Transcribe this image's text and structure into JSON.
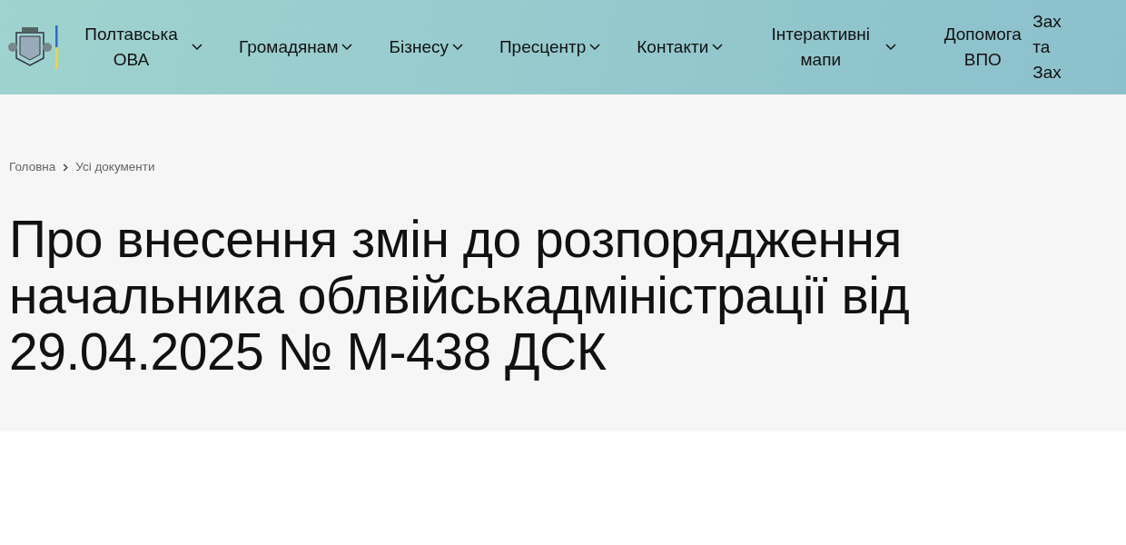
{
  "header": {
    "nav": [
      {
        "label": "Полтавська ОВА",
        "dropdown": true
      },
      {
        "label": "Громадянам",
        "dropdown": true
      },
      {
        "label": "Бізнесу",
        "dropdown": true
      },
      {
        "label": "Пресцентр",
        "dropdown": true
      },
      {
        "label": "Контакти",
        "dropdown": true
      },
      {
        "label": "Інтерактивні мапи",
        "dropdown": true
      },
      {
        "label": "Допомога ВПО",
        "dropdown": false
      },
      {
        "label": "Зах та Зах",
        "dropdown": false
      }
    ]
  },
  "breadcrumb": [
    "Головна",
    "Усі документи"
  ],
  "title": "Про внесення змін до розпорядження начальника облвійськадміністрації від 29.04.2025 № М-438 ДСК"
}
